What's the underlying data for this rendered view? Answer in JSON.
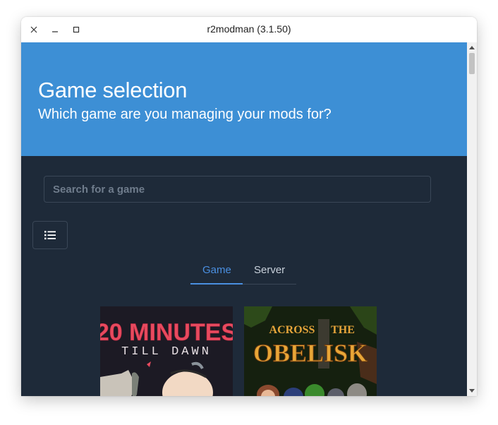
{
  "window": {
    "title": "r2modman (3.1.50)"
  },
  "hero": {
    "title": "Game selection",
    "subtitle": "Which game are you managing your mods for?",
    "background": "#3d8fd5"
  },
  "search": {
    "placeholder": "Search for a game",
    "value": ""
  },
  "view_toggle": {
    "icon": "list-icon"
  },
  "tabs": [
    {
      "label": "Game",
      "active": true
    },
    {
      "label": "Server",
      "active": false
    }
  ],
  "games": [
    {
      "title_line1": "20 MINUTES",
      "title_line2": "TILL DAWN"
    },
    {
      "title_line1": "ACROSS",
      "title_line2": "THE",
      "title_line3": "OBELISK"
    }
  ],
  "colors": {
    "content_bg": "#1e2a39",
    "accent": "#4a8fe0",
    "border": "#3a4757"
  }
}
